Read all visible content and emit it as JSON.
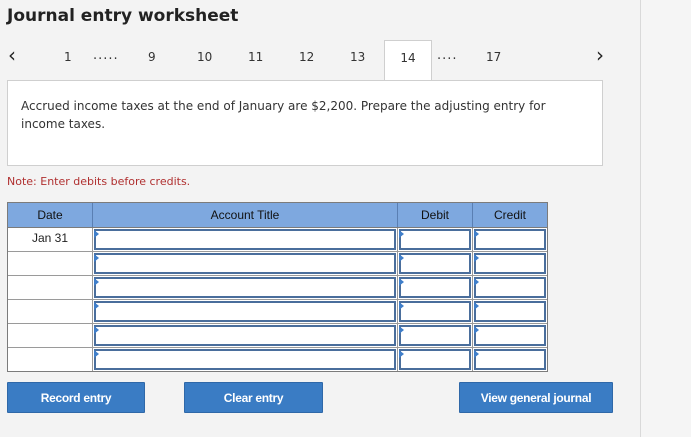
{
  "worksheet": {
    "title": "Journal entry worksheet"
  },
  "pager": {
    "prev_icon": "chevron-left-icon",
    "next_icon": "chevron-right-icon",
    "first": "1",
    "ellipsis_left": ".....",
    "pages": [
      "9",
      "10",
      "11",
      "12",
      "13"
    ],
    "active": "14",
    "ellipsis_right": "....",
    "last": "17"
  },
  "question": {
    "text": "Accrued income taxes at the end of January are $2,200. Prepare the adjusting entry for income taxes."
  },
  "note": "Note: Enter debits before credits.",
  "table": {
    "headers": {
      "date": "Date",
      "account": "Account Title",
      "debit": "Debit",
      "credit": "Credit"
    },
    "rows": [
      {
        "date": "Jan 31",
        "account": "",
        "debit": "",
        "credit": ""
      },
      {
        "date": "",
        "account": "",
        "debit": "",
        "credit": ""
      },
      {
        "date": "",
        "account": "",
        "debit": "",
        "credit": ""
      },
      {
        "date": "",
        "account": "",
        "debit": "",
        "credit": ""
      },
      {
        "date": "",
        "account": "",
        "debit": "",
        "credit": ""
      },
      {
        "date": "",
        "account": "",
        "debit": "",
        "credit": ""
      }
    ]
  },
  "buttons": {
    "record": "Record entry",
    "clear": "Clear entry",
    "view": "View general journal"
  },
  "colors": {
    "header_bg": "#7ea8df",
    "button_bg": "#3a7cc4",
    "note_text": "#b03030",
    "input_border": "#4a6e9c"
  }
}
